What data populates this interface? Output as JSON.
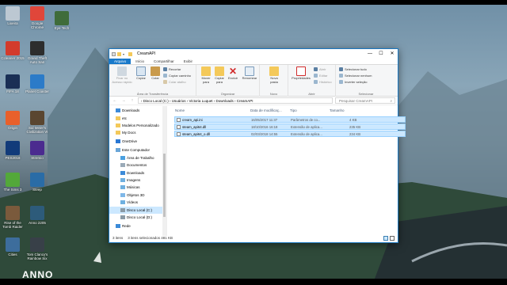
{
  "desktop": {
    "icons": [
      {
        "label": "Lixeira",
        "color": "#bcc8d2"
      },
      {
        "label": "Google Chrome",
        "color": "#e0463a"
      },
      {
        "label": "Eye Tech",
        "color": "#3f6c3a"
      },
      {
        "label": "Ccleaner 2015",
        "color": "#d33b2c"
      },
      {
        "label": "Grand Theft Auto San",
        "color": "#2d2d2d"
      },
      {
        "label": "FIFA 18",
        "color": "#1a2f55"
      },
      {
        "label": "Planet Coaster",
        "color": "#2c7bc8"
      },
      {
        "label": "Origin",
        "color": "#e8602b"
      },
      {
        "label": "Sid Meier's Civilization VI",
        "color": "#5a4630"
      },
      {
        "label": "PES2018",
        "color": "#123b7a"
      },
      {
        "label": "Stremio",
        "color": "#4b2b8f"
      },
      {
        "label": "The Sims 3",
        "color": "#53a83a"
      },
      {
        "label": "Steep",
        "color": "#2a6ca6"
      },
      {
        "label": "Rise of the Tomb Raider",
        "color": "#7a5a3c"
      },
      {
        "label": "Anno 2205",
        "color": "#2d5b7a"
      },
      {
        "label": "Cities",
        "color": "#3d6d9c"
      },
      {
        "label": "Tom Clancy's Rainbow Six",
        "color": "#384048"
      }
    ],
    "wallpaper_text": "ANNO"
  },
  "window": {
    "title": "CreamAPI",
    "controls": {
      "minimize": "—",
      "maximize": "☐",
      "close": "✕"
    },
    "tabs": [
      "Arquivo",
      "Início",
      "Compartilhar",
      "Exibir"
    ],
    "ribbon": {
      "clipboard": {
        "pin": "Fixar no Acesso rápido",
        "copy": "Copiar",
        "paste": "Colar",
        "cut": "Recortar",
        "copy_path": "Copiar caminho",
        "paste_shortcut": "Colar atalho",
        "group": "Área de Transferência"
      },
      "organize": {
        "move": "Mover para",
        "copy_to": "Copiar para",
        "delete": "Excluir",
        "rename": "Renomear",
        "group": "Organizar"
      },
      "new": {
        "new_folder": "Nova pasta",
        "group": "Novo"
      },
      "open": {
        "properties": "Propriedades",
        "open": "Abrir",
        "edit": "Editar",
        "history": "Histórico",
        "group": "Abrir"
      },
      "select": {
        "select_all": "Selecionar tudo",
        "select_none": "Selecionar nenhum",
        "invert": "Inverter seleção",
        "group": "Selecionar"
      }
    },
    "address": {
      "back": "←",
      "forward": "→",
      "up": "↑",
      "path": "›  Disco Local (C:)  ›  Usuários  ›  Victoria Luquet  ›  Downloads  ›  CreamAPI",
      "search_placeholder": "Pesquisar CreamAPI",
      "search_icon": "⌕"
    },
    "nav": [
      {
        "label": "Downloads",
        "indent": 0,
        "icon": "download-folder"
      },
      {
        "label": "etc",
        "indent": 0,
        "icon": "folder"
      },
      {
        "label": "Modelos Personalizado",
        "indent": 0,
        "icon": "folder"
      },
      {
        "label": "My Docs",
        "indent": 0,
        "icon": "folder"
      },
      {
        "label": "OneDrive",
        "indent": 0,
        "icon": "cloud"
      },
      {
        "label": "Este Computador",
        "indent": 0,
        "icon": "computer"
      },
      {
        "label": "Área de Trabalho",
        "indent": 1,
        "icon": "desktop-folder"
      },
      {
        "label": "Documentos",
        "indent": 1,
        "icon": "documents-folder"
      },
      {
        "label": "Downloads",
        "indent": 1,
        "icon": "download-folder"
      },
      {
        "label": "Imagens",
        "indent": 1,
        "icon": "pictures-folder"
      },
      {
        "label": "Músicas",
        "indent": 1,
        "icon": "music-folder"
      },
      {
        "label": "Objetos 3D",
        "indent": 1,
        "icon": "3d-folder"
      },
      {
        "label": "Vídeos",
        "indent": 1,
        "icon": "video-folder"
      },
      {
        "label": "Disco Local (C:)",
        "indent": 1,
        "icon": "drive",
        "selected": true
      },
      {
        "label": "Disco Local (D:)",
        "indent": 1,
        "icon": "drive"
      },
      {
        "label": "Rede",
        "indent": 0,
        "icon": "network"
      }
    ],
    "columns": {
      "name": "Nome",
      "date": "Data de modificaç...",
      "type": "Tipo",
      "size": "Tamanho"
    },
    "files": [
      {
        "name": "cream_api.ini",
        "date": "16/05/2017 11:37",
        "type": "Parâmetros de co...",
        "size": "4 KB"
      },
      {
        "name": "steam_api64.dll",
        "date": "18/10/2016 16:18",
        "type": "Extensão de aplica...",
        "size": "235 KB"
      },
      {
        "name": "steam_api64_o.dll",
        "date": "02/03/2018 14:55",
        "type": "Extensão de aplica...",
        "size": "234 KB"
      }
    ],
    "status": {
      "count": "3 itens",
      "selected": "3 itens selecionados  481 KB"
    }
  }
}
